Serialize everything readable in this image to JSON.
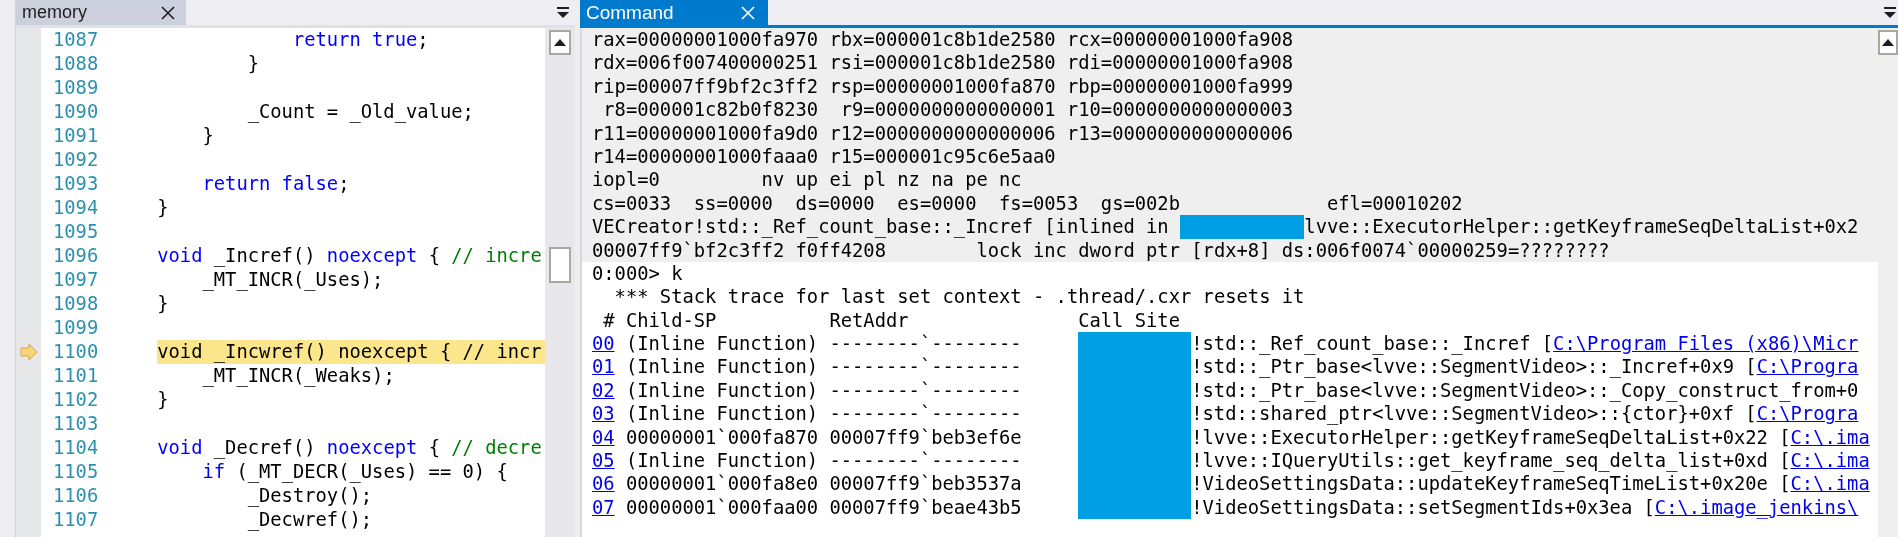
{
  "editor": {
    "tab": {
      "label": "memory",
      "active": false
    },
    "lines": [
      {
        "number": "1087",
        "current": false,
        "segments": [
          {
            "kind": "keyword",
            "text": "                return true"
          },
          {
            "kind": "plain",
            "text": ";"
          }
        ]
      },
      {
        "number": "1088",
        "current": false,
        "segments": [
          {
            "kind": "plain",
            "text": "            }"
          }
        ]
      },
      {
        "number": "1089",
        "current": false
      },
      {
        "number": "1090",
        "current": false,
        "segments": [
          {
            "kind": "plain",
            "text": "            _Count = _Old_value;"
          }
        ]
      },
      {
        "number": "1091",
        "current": false,
        "segments": [
          {
            "kind": "plain",
            "text": "        }"
          }
        ]
      },
      {
        "number": "1092",
        "current": false
      },
      {
        "number": "1093",
        "current": false,
        "segments": [
          {
            "kind": "keyword",
            "text": "        return false"
          },
          {
            "kind": "plain",
            "text": ";"
          }
        ]
      },
      {
        "number": "1094",
        "current": false,
        "segments": [
          {
            "kind": "plain",
            "text": "    }"
          }
        ]
      },
      {
        "number": "1095",
        "current": false
      },
      {
        "number": "1096",
        "current": false,
        "segments": [
          {
            "kind": "keyword",
            "text": "    void"
          },
          {
            "kind": "plain",
            "text": " _Incref() "
          },
          {
            "kind": "keyword",
            "text": "noexcept"
          },
          {
            "kind": "plain",
            "text": " { "
          },
          {
            "kind": "comment",
            "text": "// incre"
          }
        ]
      },
      {
        "number": "1097",
        "current": false,
        "segments": [
          {
            "kind": "plain",
            "text": "        _MT_INCR(_Uses);"
          }
        ]
      },
      {
        "number": "1098",
        "current": false,
        "segments": [
          {
            "kind": "plain",
            "text": "    }"
          }
        ]
      },
      {
        "number": "1099",
        "current": false
      },
      {
        "number": "1100",
        "current": true,
        "segments": [
          {
            "kind": "plain",
            "text": "    void _Incwref() noexcept { // incr"
          }
        ]
      },
      {
        "number": "1101",
        "current": false,
        "segments": [
          {
            "kind": "plain",
            "text": "        _MT_INCR(_Weaks);"
          }
        ]
      },
      {
        "number": "1102",
        "current": false,
        "segments": [
          {
            "kind": "plain",
            "text": "    }"
          }
        ]
      },
      {
        "number": "1103",
        "current": false
      },
      {
        "number": "1104",
        "current": false,
        "segments": [
          {
            "kind": "keyword",
            "text": "    void"
          },
          {
            "kind": "plain",
            "text": " _Decref() "
          },
          {
            "kind": "keyword",
            "text": "noexcept"
          },
          {
            "kind": "plain",
            "text": " { "
          },
          {
            "kind": "comment",
            "text": "// decre"
          }
        ]
      },
      {
        "number": "1105",
        "current": false,
        "segments": [
          {
            "kind": "keyword",
            "text": "        if"
          },
          {
            "kind": "plain",
            "text": " (_MT_DECR(_Uses) == 0) {"
          }
        ]
      },
      {
        "number": "1106",
        "current": false,
        "segments": [
          {
            "kind": "plain",
            "text": "            _Destroy();"
          }
        ]
      },
      {
        "number": "1107",
        "current": false,
        "segments": [
          {
            "kind": "plain",
            "text": "            _Decwref();"
          }
        ]
      }
    ]
  },
  "command": {
    "tab": {
      "label": "Command",
      "active": true
    },
    "output_lines": [
      {
        "kind": "plain",
        "text": "rax=00000001000fa970 rbx=000001c8b1de2580 rcx=00000001000fa908"
      },
      {
        "kind": "plain",
        "text": "rdx=006f007400000251 rsi=000001c8b1de2580 rdi=00000001000fa908"
      },
      {
        "kind": "plain",
        "text": "rip=00007ff9bf2c3ff2 rsp=00000001000fa870 rbp=00000001000fa999"
      },
      {
        "kind": "plain",
        "text": " r8=000001c82b0f8230  r9=0000000000000001 r10=0000000000000003"
      },
      {
        "kind": "plain",
        "text": "r11=00000001000fa9d0 r12=0000000000000006 r13=0000000000000006"
      },
      {
        "kind": "plain",
        "text": "r14=00000001000faaa0 r15=000001c95c6e5aa0"
      },
      {
        "kind": "plain",
        "text": "iopl=0         nv up ei pl nz na pe nc"
      },
      {
        "kind": "plain",
        "text": "cs=0033  ss=0000  ds=0000  es=0000  fs=0053  gs=002b             efl=00010202"
      },
      {
        "kind": "redacted",
        "before": "VECreator!std::_Ref_count_base::_Incref [inlined in ",
        "after": "lvve::ExecutorHelper::getKeyframeSeqDeltaList+0x2"
      },
      {
        "kind": "plain",
        "text": "00007ff9`bf2c3ff2 f0ff4208        lock inc dword ptr [rdx+8] ds:006f0074`00000259=????????"
      }
    ],
    "prompt": "0:000> k",
    "notice": "  *** Stack trace for last set context - .thread/.cxr resets it",
    "stack_trace": {
      "columns": [
        "#",
        "Child-SP",
        "RetAddr",
        "Call Site"
      ],
      "rows": [
        {
          "frame": "00",
          "child_sp": "(Inline Function)",
          "ret_addr": "--------`--------",
          "call_site": "!std::_Ref_count_base::_Incref [",
          "source": "C:\\Program Files (x86)\\Micr"
        },
        {
          "frame": "01",
          "child_sp": "(Inline Function)",
          "ret_addr": "--------`--------",
          "call_site": "!std::_Ptr_base<lvve::SegmentVideo>::_Incref+0x9 [",
          "source": "C:\\Progra"
        },
        {
          "frame": "02",
          "child_sp": "(Inline Function)",
          "ret_addr": "--------`--------",
          "call_site": "!std::_Ptr_base<lvve::SegmentVideo>::_Copy_construct_from+0"
        },
        {
          "frame": "03",
          "child_sp": "(Inline Function)",
          "ret_addr": "--------`--------",
          "call_site": "!std::shared_ptr<lvve::SegmentVideo>::{ctor}+0xf [",
          "source": "C:\\Progra"
        },
        {
          "frame": "04",
          "child_sp": "00000001`000fa870",
          "ret_addr": "00007ff9`beb3ef6e",
          "call_site": "!lvve::ExecutorHelper::getKeyframeSeqDeltaList+0x22 [",
          "source": "C:\\.ima"
        },
        {
          "frame": "05",
          "child_sp": "(Inline Function)",
          "ret_addr": "--------`--------",
          "call_site": "!lvve::IQueryUtils::get_keyframe_seq_delta_list+0xd [",
          "source": "C:\\.ima"
        },
        {
          "frame": "06",
          "child_sp": "00000001`000fa8e0",
          "ret_addr": "00007ff9`beb3537a",
          "call_site": "!VideoSettingsData::updateKeyframeSeqTimeList+0x20e [",
          "source": "C:\\.ima"
        },
        {
          "frame": "07",
          "child_sp": "00000001`000faa00",
          "ret_addr": "00007ff9`beae43b5",
          "call_site": "!VideoSettingsData::setSegmentIds+0x3ea [",
          "source": "C:\\.image_jenkins\\"
        }
      ]
    }
  }
}
